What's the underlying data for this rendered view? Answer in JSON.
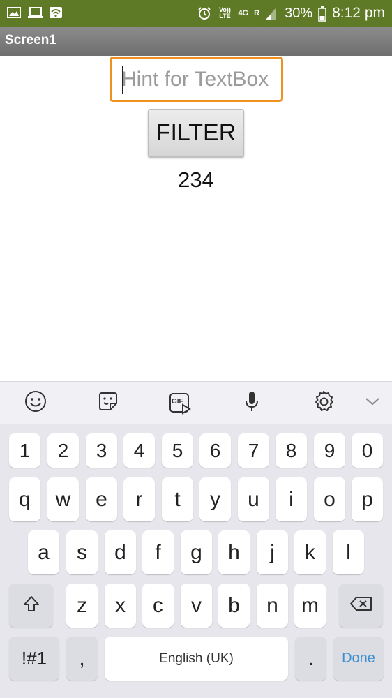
{
  "status_bar": {
    "icons_left": [
      "image-icon",
      "laptop-icon",
      "wifi-icon"
    ],
    "volte_label": "Vo)) LTE",
    "network_label": "4G",
    "roaming_label": "R",
    "battery_percent": "30%",
    "time": "8:12 pm"
  },
  "title_bar": {
    "title": "Screen1"
  },
  "content": {
    "textbox_placeholder": "Hint for TextBox",
    "textbox_value": "",
    "filter_button_label": "FILTER",
    "result_label": "234"
  },
  "keyboard": {
    "toolbar_icons": [
      "emoji-icon",
      "sticker-icon",
      "gif-icon",
      "microphone-icon",
      "settings-icon",
      "chevron-down-icon"
    ],
    "gif_label": "GIF",
    "number_row": [
      "1",
      "2",
      "3",
      "4",
      "5",
      "6",
      "7",
      "8",
      "9",
      "0"
    ],
    "row1": [
      "q",
      "w",
      "e",
      "r",
      "t",
      "y",
      "u",
      "i",
      "o",
      "p"
    ],
    "row2": [
      "a",
      "s",
      "d",
      "f",
      "g",
      "h",
      "j",
      "k",
      "l"
    ],
    "row3": [
      "z",
      "x",
      "c",
      "v",
      "b",
      "n",
      "m"
    ],
    "symbols_label": "!#1",
    "comma_label": ",",
    "space_label": "English (UK)",
    "period_label": ".",
    "done_label": "Done",
    "accent_color": "#3b8fd0"
  },
  "colors": {
    "status_bar": "#5e7a26",
    "textbox_border": "#f0901e",
    "title_bar": "#7d7d7d"
  }
}
